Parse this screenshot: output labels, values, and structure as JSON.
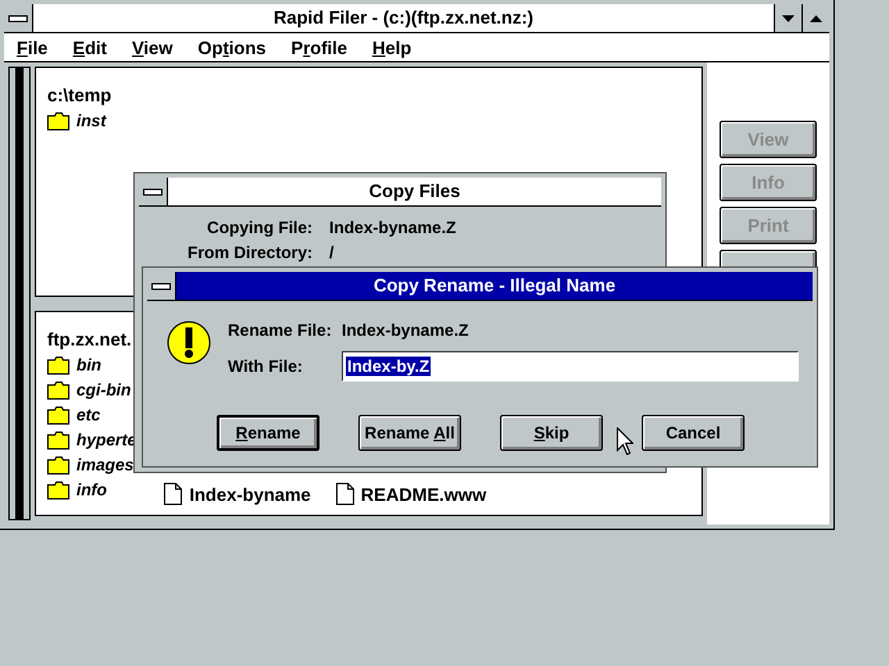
{
  "window": {
    "title": "Rapid Filer - (c:)(ftp.zx.net.nz:)"
  },
  "menu": [
    {
      "key": "F",
      "rest": "ile"
    },
    {
      "key": "E",
      "rest": "dit"
    },
    {
      "key": "V",
      "rest": "iew"
    },
    {
      "lead": "Op",
      "key": "t",
      "rest": "ions"
    },
    {
      "lead": "P",
      "key": "r",
      "rest": "ofile"
    },
    {
      "key": "H",
      "rest": "elp"
    }
  ],
  "upper_panel": {
    "path": "c:\\temp",
    "folders": [
      "inst"
    ]
  },
  "lower_panel": {
    "path": "ftp.zx.net.",
    "folders": [
      "bin",
      "cgi-bin",
      "etc",
      "hyperte",
      "images",
      "info"
    ],
    "files": [
      "Index-byname",
      "README.www"
    ]
  },
  "side_buttons": [
    {
      "label": "View",
      "disabled": true
    },
    {
      "label": "Info",
      "disabled": true
    },
    {
      "label": "Print",
      "disabled": true
    }
  ],
  "copy_files_dialog": {
    "title": "Copy Files",
    "active": false,
    "fields": [
      {
        "label": "Copying File:",
        "value": "Index-byname.Z"
      },
      {
        "label": "From Directory:",
        "value": "/"
      }
    ]
  },
  "rename_dialog": {
    "title": "Copy Rename - Illegal Name",
    "active": true,
    "rename_label": "Rename File:",
    "rename_value": "Index-byname.Z",
    "with_label": "With File:",
    "with_value": "Index-by.Z",
    "buttons": [
      {
        "key": "R",
        "rest": "ename",
        "default": true
      },
      {
        "lead": "Rename ",
        "key": "A",
        "rest": "ll",
        "default": false
      },
      {
        "key": "S",
        "rest": "kip",
        "default": false
      },
      {
        "lead": "Cancel",
        "default": false
      }
    ]
  }
}
